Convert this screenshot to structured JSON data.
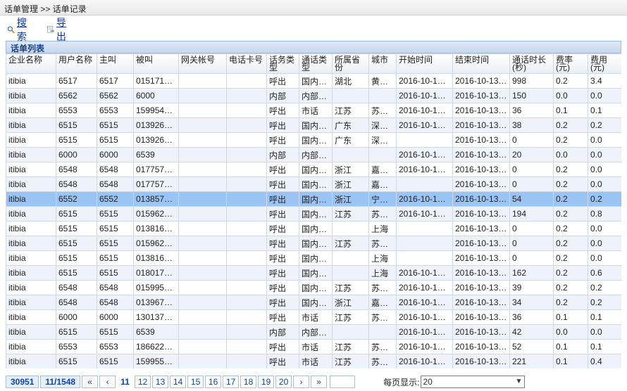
{
  "breadcrumb": "话单管理 >> 话单记录",
  "toolbar": {
    "search_label": "搜索",
    "export_label": "导出"
  },
  "panel_title": "话单列表",
  "columns": [
    "企业名称",
    "用户名称",
    "主叫",
    "被叫",
    "网关帐号",
    "电话卡号",
    "话务类型",
    "通话类型",
    "所属省份",
    "城市",
    "开始时间",
    "结束时间",
    "通话时长(秒)",
    "费率(元)",
    "费用(元)"
  ],
  "rows": [
    [
      "itibia",
      "6517",
      "6517",
      "015171…",
      "",
      "",
      "呼出",
      "国内…",
      "湖北",
      "黄冈市",
      "2016-10-13…",
      "2016-10-13…",
      "998",
      "0.2",
      "3.4"
    ],
    [
      "itibia",
      "6562",
      "6562",
      "6000",
      "",
      "",
      "内部",
      "内部…",
      "",
      "",
      "2016-10-13…",
      "2016-10-13…",
      "150",
      "0.0",
      "0.0"
    ],
    [
      "itibia",
      "6553",
      "6553",
      "159954…",
      "",
      "",
      "呼出",
      "市话",
      "江苏",
      "苏州市",
      "2016-10-13…",
      "2016-10-13…",
      "36",
      "0.1",
      "0.1"
    ],
    [
      "itibia",
      "6515",
      "6515",
      "013926…",
      "",
      "",
      "呼出",
      "国内…",
      "广东",
      "深圳市",
      "2016-10-13…",
      "2016-10-13…",
      "38",
      "0.2",
      "0.2"
    ],
    [
      "itibia",
      "6515",
      "6515",
      "013926…",
      "",
      "",
      "呼出",
      "国内…",
      "广东",
      "深圳市",
      "",
      "2016-10-13…",
      "0",
      "0.2",
      "0.0"
    ],
    [
      "itibia",
      "6000",
      "6000",
      "6539",
      "",
      "",
      "内部",
      "内部…",
      "",
      "",
      "2016-10-13…",
      "2016-10-13…",
      "20",
      "0.0",
      "0.0"
    ],
    [
      "itibia",
      "6548",
      "6548",
      "017757…",
      "",
      "",
      "呼出",
      "国内…",
      "浙江",
      "嘉兴市",
      "2016-10-13…",
      "2016-10-13…",
      "0",
      "0.2",
      "0.0"
    ],
    [
      "itibia",
      "6548",
      "6548",
      "017757…",
      "",
      "",
      "呼出",
      "国内…",
      "浙江",
      "嘉兴市",
      "",
      "2016-10-13…",
      "0",
      "0.2",
      "0.0"
    ],
    [
      "itibia",
      "6552",
      "6552",
      "013857…",
      "",
      "",
      "呼出",
      "国内…",
      "浙江",
      "宁波市",
      "2016-10-13…",
      "2016-10-13…",
      "54",
      "0.2",
      "0.2"
    ],
    [
      "itibia",
      "6515",
      "6515",
      "015962…",
      "",
      "",
      "呼出",
      "国内…",
      "江苏",
      "苏州市",
      "2016-10-13…",
      "2016-10-13…",
      "194",
      "0.2",
      "0.8"
    ],
    [
      "itibia",
      "6515",
      "6515",
      "013816…",
      "",
      "",
      "呼出",
      "国内…",
      "",
      "上海",
      "",
      "2016-10-13…",
      "0",
      "0.2",
      "0.0"
    ],
    [
      "itibia",
      "6515",
      "6515",
      "015962…",
      "",
      "",
      "呼出",
      "国内…",
      "江苏",
      "苏州市",
      "",
      "2016-10-13…",
      "0",
      "0.2",
      "0.0"
    ],
    [
      "itibia",
      "6515",
      "6515",
      "013816…",
      "",
      "",
      "呼出",
      "国内…",
      "",
      "上海",
      "",
      "2016-10-13…",
      "0",
      "0.2",
      "0.0"
    ],
    [
      "itibia",
      "6515",
      "6515",
      "018017…",
      "",
      "",
      "呼出",
      "国内…",
      "",
      "上海",
      "2016-10-13…",
      "2016-10-13…",
      "162",
      "0.2",
      "0.6"
    ],
    [
      "itibia",
      "6548",
      "6548",
      "015995…",
      "",
      "",
      "呼出",
      "国内…",
      "江苏",
      "苏州市",
      "2016-10-13…",
      "2016-10-13…",
      "39",
      "0.2",
      "0.2"
    ],
    [
      "itibia",
      "6548",
      "6548",
      "013967…",
      "",
      "",
      "呼出",
      "国内…",
      "浙江",
      "嘉兴市",
      "2016-10-13…",
      "2016-10-13…",
      "34",
      "0.2",
      "0.2"
    ],
    [
      "itibia",
      "6000",
      "6000",
      "130137…",
      "",
      "",
      "呼出",
      "市话",
      "江苏",
      "苏州市",
      "2016-10-13…",
      "2016-10-13…",
      "36",
      "0.1",
      "0.1"
    ],
    [
      "itibia",
      "6515",
      "6515",
      "6539",
      "",
      "",
      "内部",
      "内部…",
      "",
      "",
      "2016-10-13…",
      "2016-10-13…",
      "42",
      "0.0",
      "0.0"
    ],
    [
      "itibia",
      "6553",
      "6553",
      "186622…",
      "",
      "",
      "呼出",
      "市话",
      "江苏",
      "苏州市",
      "2016-10-13…",
      "2016-10-13…",
      "52",
      "0.1",
      "0.1"
    ],
    [
      "itibia",
      "6515",
      "6515",
      "159955…",
      "",
      "",
      "呼出",
      "市话",
      "江苏",
      "苏州市",
      "2016-10-13…",
      "2016-10-13…",
      "221",
      "0.1",
      "0.4"
    ]
  ],
  "selected_row": 8,
  "pager": {
    "total_records": "30951",
    "page_info": "11/1548",
    "first": "«",
    "prev": "‹",
    "pages": [
      "11",
      "12",
      "13",
      "14",
      "15",
      "16",
      "17",
      "18",
      "19",
      "20"
    ],
    "current_page": "11",
    "next": "›",
    "last": "»",
    "page_size_label": "每页显示:",
    "page_size_value": "20"
  },
  "colors": {
    "header_blue": "#15428b",
    "selected_row": "#99c4f4",
    "alt_row": "#eef3fb",
    "link": "#1133aa"
  },
  "icons": {
    "search": "search-icon",
    "export": "export-icon"
  }
}
